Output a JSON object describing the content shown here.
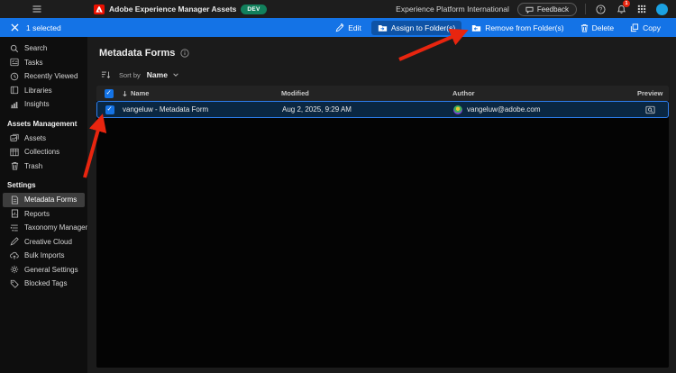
{
  "topbar": {
    "app_title": "Adobe Experience Manager Assets",
    "env_badge": "DEV",
    "org_label": "Experience Platform International",
    "feedback_label": "Feedback",
    "notification_count": "1"
  },
  "action_bar": {
    "selected_label": "1 selected",
    "edit_label": "Edit",
    "assign_label": "Assign to Folder(s)",
    "remove_label": "Remove from Folder(s)",
    "delete_label": "Delete",
    "copy_label": "Copy"
  },
  "sidebar": {
    "items_top": [
      {
        "label": "Search"
      },
      {
        "label": "Tasks"
      },
      {
        "label": "Recently Viewed"
      },
      {
        "label": "Libraries"
      },
      {
        "label": "Insights"
      }
    ],
    "section_assets": {
      "header": "Assets Management",
      "items": [
        {
          "label": "Assets"
        },
        {
          "label": "Collections"
        },
        {
          "label": "Trash"
        }
      ]
    },
    "section_settings": {
      "header": "Settings",
      "items": [
        {
          "label": "Metadata Forms"
        },
        {
          "label": "Reports"
        },
        {
          "label": "Taxonomy Management"
        },
        {
          "label": "Creative Cloud"
        },
        {
          "label": "Bulk Imports"
        },
        {
          "label": "General Settings"
        },
        {
          "label": "Blocked Tags"
        }
      ]
    }
  },
  "main": {
    "title": "Metadata Forms",
    "sort": {
      "label": "Sort by",
      "value": "Name"
    },
    "table": {
      "col_name": "Name",
      "col_modified": "Modified",
      "col_author": "Author",
      "col_preview": "Preview",
      "rows": [
        {
          "name": "vangeluw - Metadata Form",
          "modified": "Aug 2, 2025, 9:29 AM",
          "author": "vangeluw@adobe.com"
        }
      ]
    }
  },
  "colors": {
    "accent_blue": "#1473e6",
    "badge_green": "#12805c",
    "arrow_red": "#e8250f",
    "selected_row_bg": "#0a2742",
    "selected_row_border": "#2d7ff0"
  }
}
